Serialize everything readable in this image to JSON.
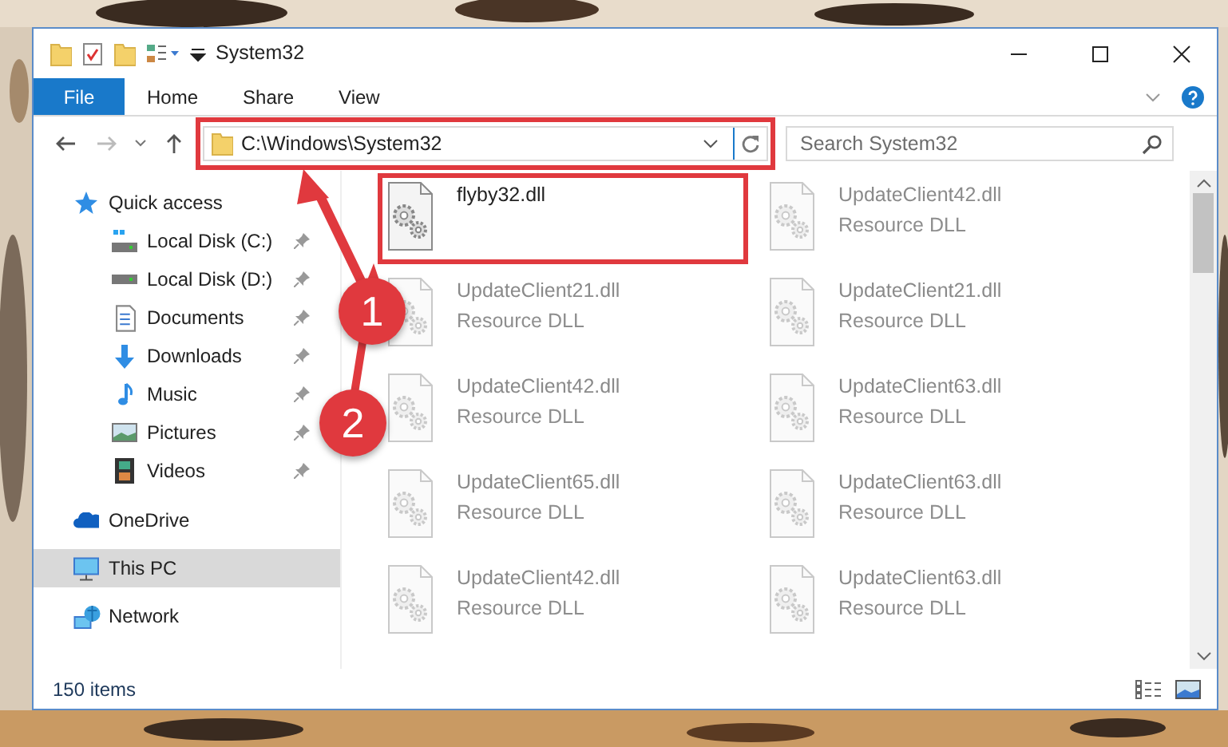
{
  "window": {
    "title": "System32"
  },
  "ribbon_tabs": [
    {
      "label": "File",
      "kind": "file",
      "selected": false
    },
    {
      "label": "Home",
      "kind": "tab",
      "selected": false
    },
    {
      "label": "Share",
      "kind": "tab",
      "selected": false
    },
    {
      "label": "View",
      "kind": "tab",
      "selected": false
    }
  ],
  "address": {
    "path": "C:\\Windows\\System32"
  },
  "search": {
    "placeholder": "Search System32"
  },
  "sidebar": {
    "items": [
      {
        "label": "Quick access",
        "kind": "star",
        "selected": false,
        "children": [
          {
            "label": "Local Disk (C:)",
            "kind": "windrive",
            "pinned": true,
            "selected": false
          },
          {
            "label": "Local Disk (D:)",
            "kind": "drive",
            "pinned": true,
            "selected": false
          },
          {
            "label": "Documents",
            "kind": "document",
            "pinned": true,
            "selected": false
          },
          {
            "label": "Downloads",
            "kind": "download",
            "pinned": true,
            "selected": false
          },
          {
            "label": "Music",
            "kind": "music",
            "pinned": true,
            "selected": false
          },
          {
            "label": "Pictures",
            "kind": "picture",
            "pinned": true,
            "selected": false
          },
          {
            "label": "Videos",
            "kind": "video",
            "pinned": true,
            "selected": false
          }
        ]
      },
      {
        "label": "OneDrive",
        "kind": "cloud",
        "selected": false
      },
      {
        "label": "This PC",
        "kind": "computer",
        "selected": true
      },
      {
        "label": "Network",
        "kind": "network",
        "selected": false
      }
    ]
  },
  "files": [
    {
      "name": "flyby32.dll",
      "blurred": false
    },
    {
      "name": "UpdateClient42.dll",
      "type": "Resource DLL",
      "blurred": true
    },
    {
      "name": "UpdateClient21.dll",
      "type": "Resource DLL",
      "blurred": true
    },
    {
      "name": "UpdateClient21.dll",
      "type": "Resource DLL",
      "blurred": true
    },
    {
      "name": "UpdateClient42.dll",
      "type": "Resource DLL",
      "blurred": true
    },
    {
      "name": "UpdateClient63.dll",
      "type": "Resource DLL",
      "blurred": true
    },
    {
      "name": "UpdateClient65.dll",
      "type": "Resource DLL",
      "blurred": true
    },
    {
      "name": "UpdateClient63.dll",
      "type": "Resource DLL",
      "blurred": true
    },
    {
      "name": "UpdateClient42.dll",
      "type": "Resource DLL",
      "blurred": true
    },
    {
      "name": "UpdateClient63.dll",
      "type": "Resource DLL",
      "blurred": true
    }
  ],
  "status_bar": {
    "count": "150 items"
  },
  "annotations": [
    {
      "label": "1"
    },
    {
      "label": "2"
    }
  ]
}
